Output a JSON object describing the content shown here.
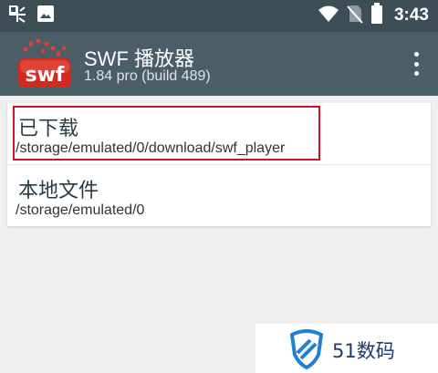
{
  "status_bar": {
    "time": "3:43",
    "left_icons": [
      "notification-app-icon",
      "image-icon"
    ],
    "right_icons": [
      "wifi-icon",
      "no-sim-icon",
      "battery-icon"
    ]
  },
  "app_bar": {
    "logo_text": "swf",
    "title": "SWF 播放器",
    "subtitle": "1.84 pro (build 489)",
    "menu_icon": "overflow-menu-icon"
  },
  "folders": [
    {
      "title": "已下载",
      "path": "/storage/emulated/0/download/swf_player"
    },
    {
      "title": "本地文件",
      "path": "/storage/emulated/0"
    }
  ],
  "colors": {
    "status_bar": "#3d4e57",
    "app_bar": "#4b5d66",
    "background": "#efefef",
    "highlight": "#d0112b",
    "logo_red": "#d42a1e",
    "watermark_blue": "#1e3a6a"
  },
  "watermark": {
    "text": "51数码"
  }
}
